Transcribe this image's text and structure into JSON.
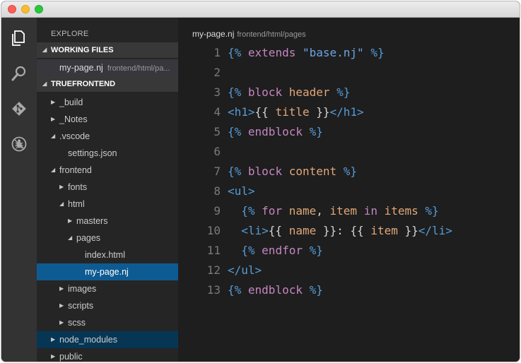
{
  "sidebar": {
    "title": "EXPLORE",
    "working_files": {
      "label": "WORKING FILES",
      "file": "my-page.nj",
      "path": "frontend/html/pa..."
    },
    "project": {
      "label": "TRUEFRONTEND"
    },
    "tree": [
      {
        "label": "_build",
        "depth": 1,
        "expanded": false
      },
      {
        "label": "_Notes",
        "depth": 1,
        "expanded": false
      },
      {
        "label": ".vscode",
        "depth": 1,
        "expanded": true
      },
      {
        "label": "settings.json",
        "depth": 2,
        "file": true
      },
      {
        "label": "frontend",
        "depth": 1,
        "expanded": true
      },
      {
        "label": "fonts",
        "depth": 2,
        "expanded": false
      },
      {
        "label": "html",
        "depth": 2,
        "expanded": true
      },
      {
        "label": "masters",
        "depth": 3,
        "expanded": false
      },
      {
        "label": "pages",
        "depth": 3,
        "expanded": true
      },
      {
        "label": "index.html",
        "depth": 4,
        "file": true
      },
      {
        "label": "my-page.nj",
        "depth": 4,
        "file": true,
        "selected": true
      },
      {
        "label": "images",
        "depth": 2,
        "expanded": false
      },
      {
        "label": "scripts",
        "depth": 2,
        "expanded": false
      },
      {
        "label": "scss",
        "depth": 2,
        "expanded": false
      },
      {
        "label": "node_modules",
        "depth": 1,
        "expanded": false,
        "focused": true
      },
      {
        "label": "public",
        "depth": 1,
        "expanded": false
      }
    ]
  },
  "activity": [
    "files-icon",
    "search-icon",
    "git-icon",
    "debug-icon"
  ],
  "editor": {
    "file": "my-page.nj",
    "path": "frontend/html/pages",
    "lines": [
      [
        [
          "{% ",
          "d"
        ],
        [
          "extends",
          "k"
        ],
        [
          " ",
          "p"
        ],
        [
          "\"base.nj\"",
          "s"
        ],
        [
          " %}",
          "d"
        ]
      ],
      [],
      [
        [
          "{% ",
          "d"
        ],
        [
          "block",
          "k"
        ],
        [
          " ",
          "p"
        ],
        [
          "header",
          "n"
        ],
        [
          " %}",
          "d"
        ]
      ],
      [
        [
          "<h1>",
          "t"
        ],
        [
          "{{ ",
          "p"
        ],
        [
          "title",
          "n"
        ],
        [
          " }}",
          "p"
        ],
        [
          "</h1>",
          "t"
        ]
      ],
      [
        [
          "{% ",
          "d"
        ],
        [
          "endblock",
          "k"
        ],
        [
          " %}",
          "d"
        ]
      ],
      [],
      [
        [
          "{% ",
          "d"
        ],
        [
          "block",
          "k"
        ],
        [
          " ",
          "p"
        ],
        [
          "content",
          "n"
        ],
        [
          " %}",
          "d"
        ]
      ],
      [
        [
          "<ul>",
          "t"
        ]
      ],
      [
        [
          "  ",
          "p"
        ],
        [
          "{% ",
          "d"
        ],
        [
          "for",
          "k"
        ],
        [
          " ",
          "p"
        ],
        [
          "name",
          "n"
        ],
        [
          ", ",
          "p"
        ],
        [
          "item",
          "n"
        ],
        [
          " ",
          "p"
        ],
        [
          "in",
          "k"
        ],
        [
          " ",
          "p"
        ],
        [
          "items",
          "n"
        ],
        [
          " %}",
          "d"
        ]
      ],
      [
        [
          "  ",
          "p"
        ],
        [
          "<li>",
          "t"
        ],
        [
          "{{ ",
          "p"
        ],
        [
          "name",
          "n"
        ],
        [
          " }}",
          "p"
        ],
        [
          ": ",
          "p"
        ],
        [
          "{{ ",
          "p"
        ],
        [
          "item",
          "n"
        ],
        [
          " }}",
          "p"
        ],
        [
          "</li>",
          "t"
        ]
      ],
      [
        [
          "  ",
          "p"
        ],
        [
          "{% ",
          "d"
        ],
        [
          "endfor",
          "k"
        ],
        [
          " %}",
          "d"
        ]
      ],
      [
        [
          "</ul>",
          "t"
        ]
      ],
      [
        [
          "{% ",
          "d"
        ],
        [
          "endblock",
          "k"
        ],
        [
          " %}",
          "d"
        ]
      ]
    ]
  }
}
